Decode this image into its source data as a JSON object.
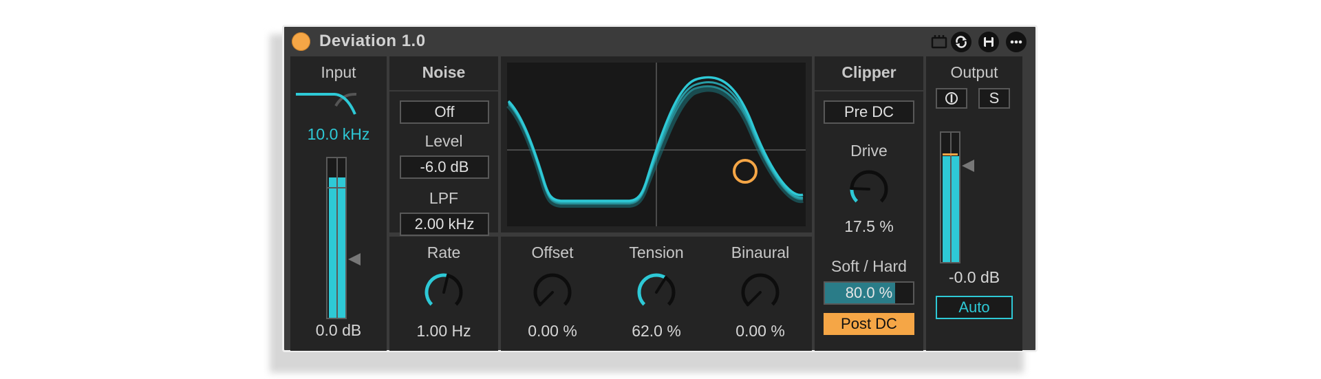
{
  "window": {
    "title": "Deviation 1.0"
  },
  "titlebar_icons": [
    "midi-map-icon",
    "refresh-icon",
    "save-icon",
    "more-icon"
  ],
  "colors": {
    "accent": "#2ec9d6",
    "orange": "#f5a646",
    "panel": "#242424",
    "frame": "#3b3b3b"
  },
  "input": {
    "title": "Input",
    "filter_freq": "10.0 kHz",
    "meter_db": "0.0 dB",
    "meter_level": 0.88
  },
  "noise": {
    "title": "Noise",
    "mode": "Off",
    "level_label": "Level",
    "level_value": "-6.0 dB",
    "lpf_label": "LPF",
    "lpf_value": "2.00 kHz"
  },
  "rate": {
    "label": "Rate",
    "value": "1.00 Hz",
    "knob": 0.55
  },
  "offset": {
    "label": "Offset",
    "value": "0.00 %",
    "knob": 0.0
  },
  "tension": {
    "label": "Tension",
    "value": "62.0 %",
    "knob": 0.62
  },
  "binaural": {
    "label": "Binaural",
    "value": "0.00 %",
    "knob": 0.0
  },
  "clipper": {
    "title": "Clipper",
    "mode": "Pre DC",
    "drive_label": "Drive",
    "drive_value": "17.5 %",
    "drive_knob": 0.175,
    "softhard_label": "Soft / Hard",
    "softhard_value": "80.0 %",
    "softhard_level": 0.8,
    "post_dc": "Post DC"
  },
  "output": {
    "title": "Output",
    "phase_icon": "phase-invert-icon",
    "solo": "S",
    "meter_db": "-0.0 dB",
    "meter_level": 0.82,
    "auto": "Auto"
  }
}
